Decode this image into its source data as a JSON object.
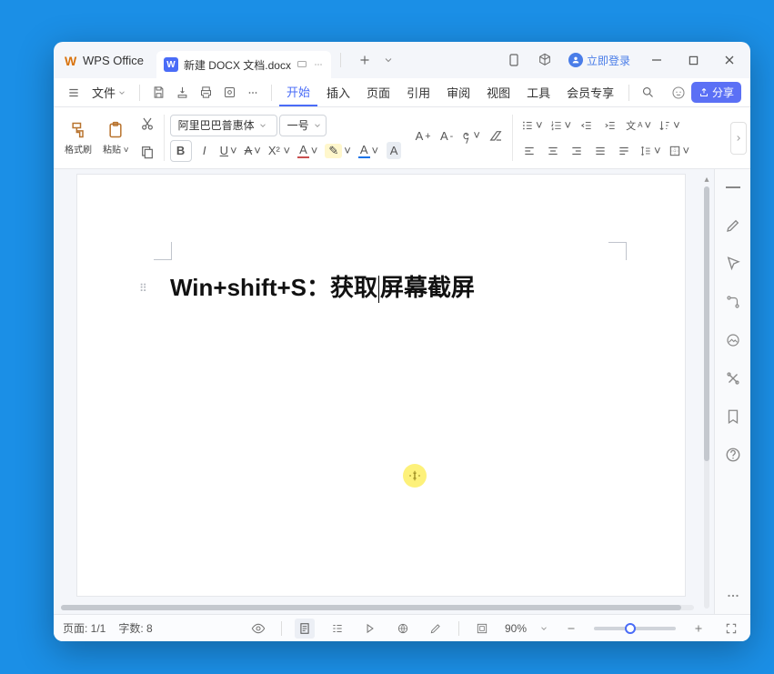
{
  "app": {
    "title": "WPS Office"
  },
  "tab": {
    "document_name": "新建 DOCX 文档.docx"
  },
  "login": {
    "label": "立即登录"
  },
  "menu": {
    "file": "文件",
    "tabs": [
      "开始",
      "插入",
      "页面",
      "引用",
      "审阅",
      "视图",
      "工具",
      "会员专享"
    ],
    "share": "分享"
  },
  "ribbon": {
    "format_painter": "格式刷",
    "paste": "粘贴",
    "font_name": "阿里巴巴普惠体",
    "font_size": "一号"
  },
  "document": {
    "text_before": "Win+shift+S：获取",
    "text_after": "屏幕截屏"
  },
  "status": {
    "page": "页面: 1/1",
    "words": "字数: 8",
    "zoom": "90%"
  }
}
